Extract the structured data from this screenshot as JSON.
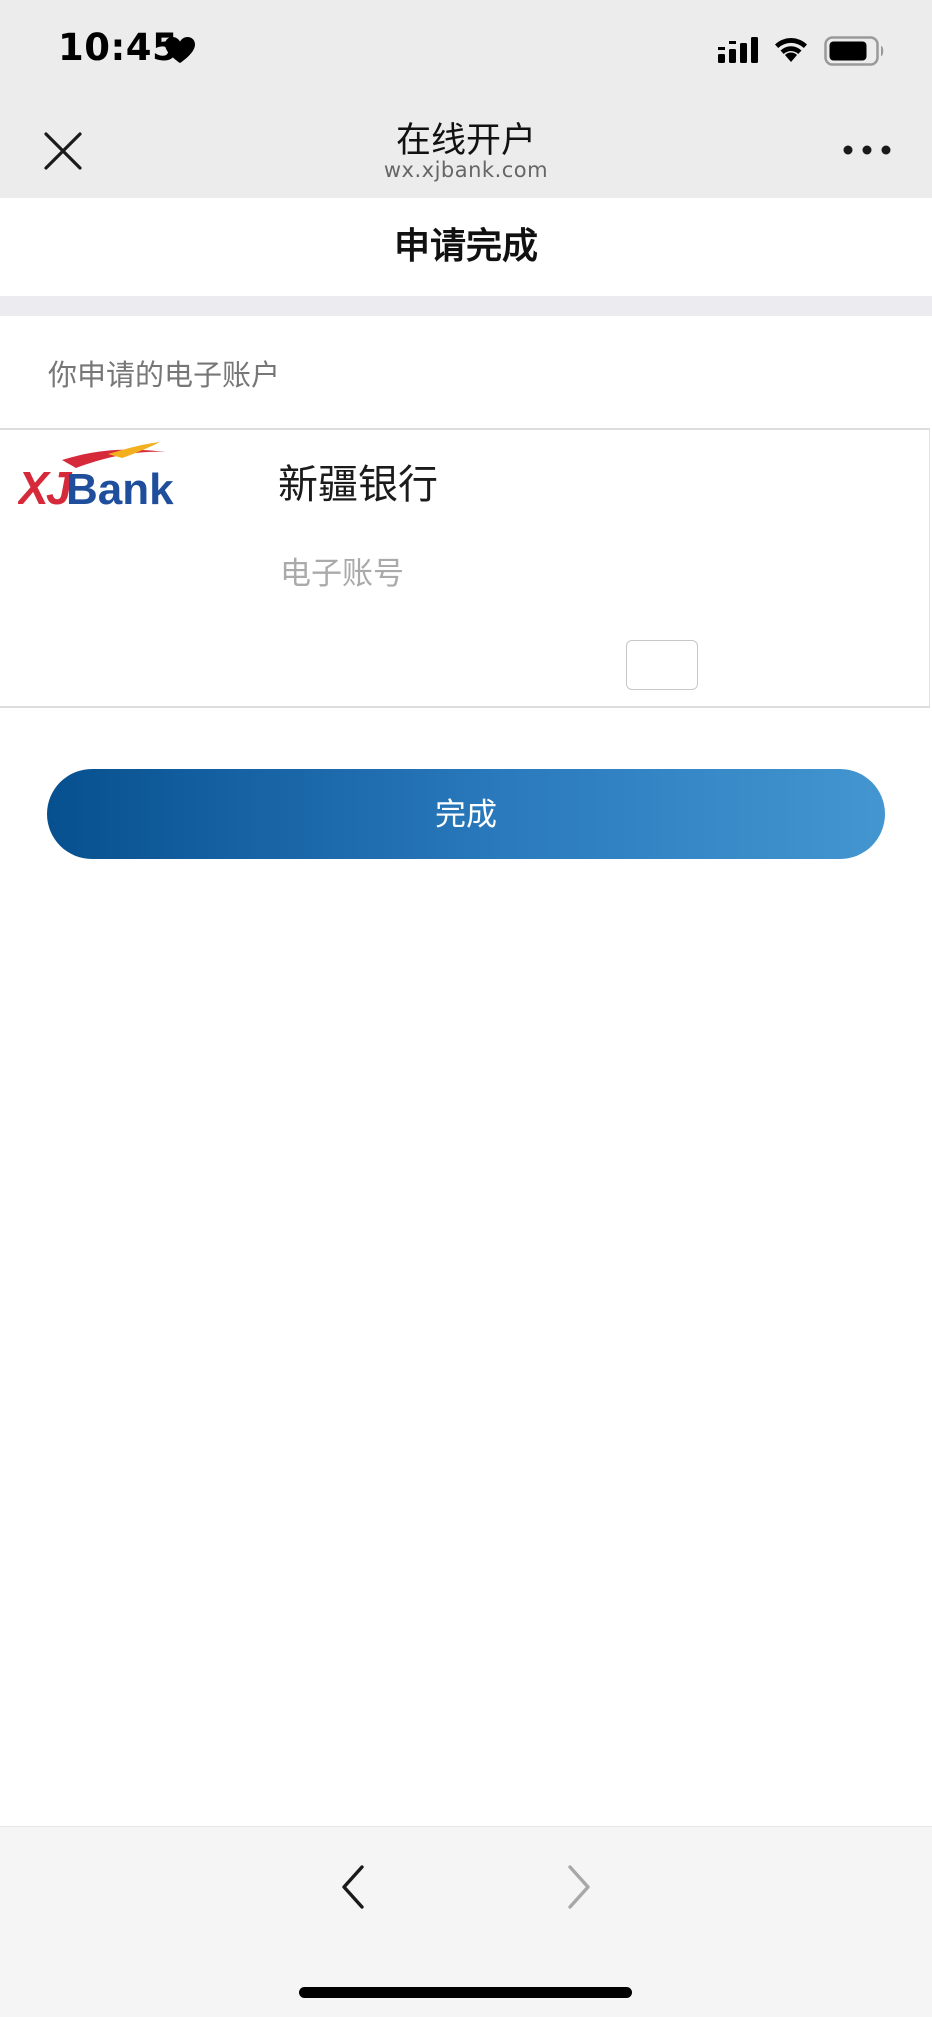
{
  "status_bar": {
    "time": "10:45",
    "icons": [
      "heart-icon",
      "cellular-signal-icon",
      "wifi-icon",
      "battery-icon"
    ]
  },
  "nav": {
    "title": "在线开户",
    "url": "wx.xjbank.com",
    "close_icon": "close-icon",
    "more_icon": "more-icon"
  },
  "page": {
    "header": "申请完成",
    "section_label": "你申请的电子账户"
  },
  "account_card": {
    "logo_text": "XJBank",
    "bank_name": "新疆银行",
    "account_label": "电子账号"
  },
  "actions": {
    "finish_label": "完成"
  },
  "colors": {
    "button_gradient_start": "#07508f",
    "button_gradient_end": "#4396d0",
    "logo_red": "#d62a3a",
    "logo_blue": "#1f4f9c",
    "logo_gold": "#f2b01e"
  },
  "bottom_bar": {
    "back_icon": "chevron-left-icon",
    "forward_icon": "chevron-right-icon"
  }
}
